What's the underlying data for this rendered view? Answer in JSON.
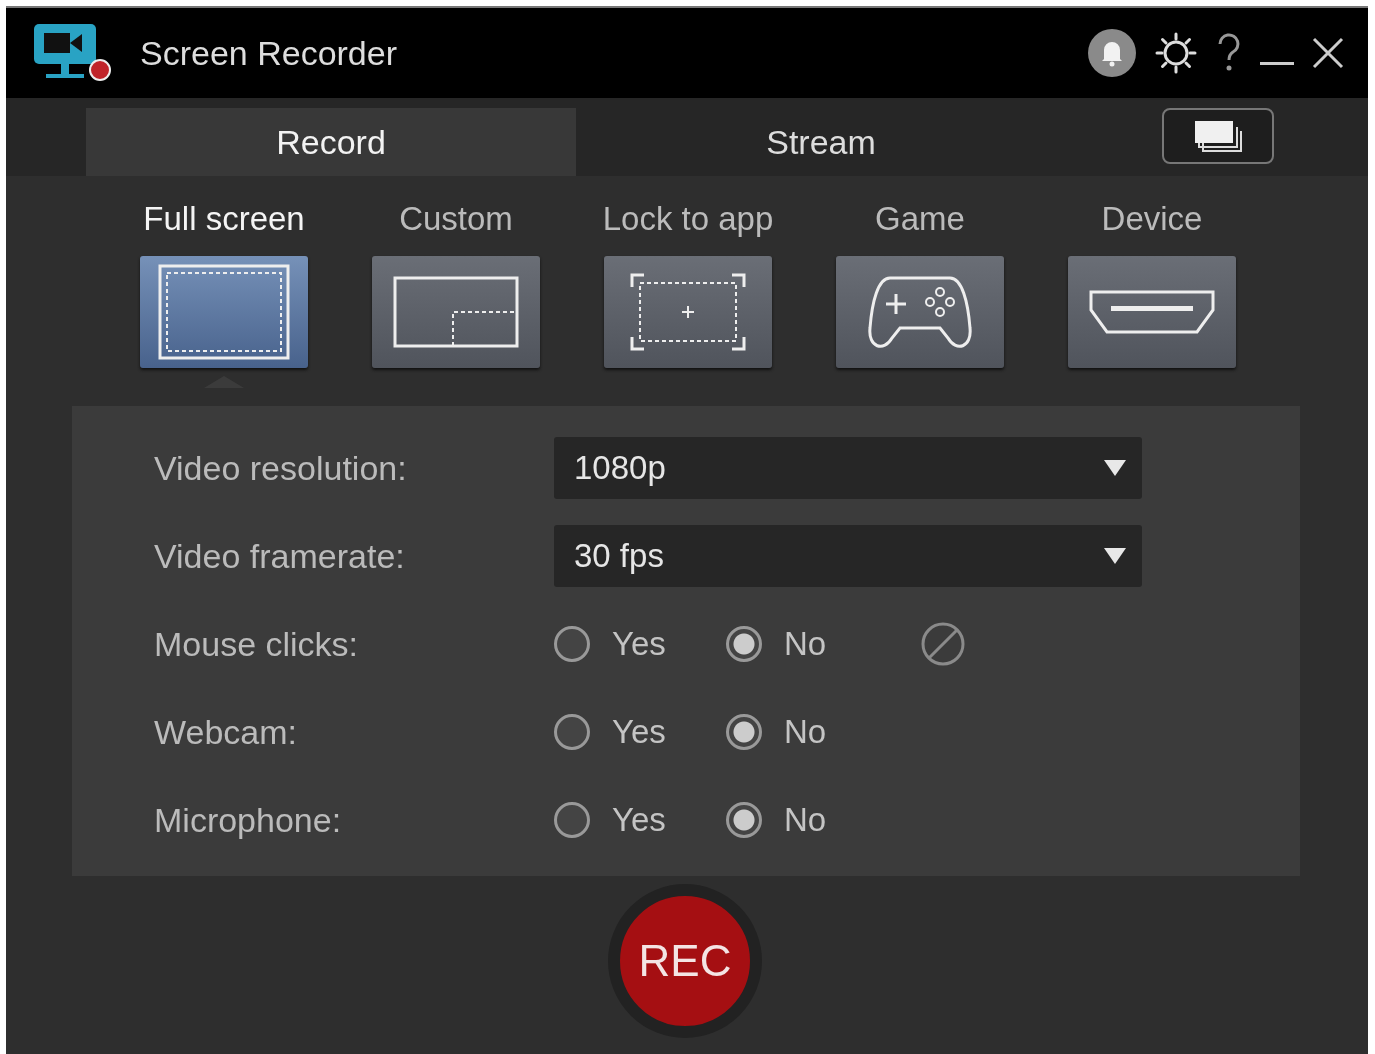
{
  "window": {
    "title": "Screen Recorder"
  },
  "tabs": [
    {
      "label": "Record",
      "selected": true
    },
    {
      "label": "Stream",
      "selected": false
    }
  ],
  "modes": [
    {
      "label": "Full screen",
      "kind": "fullscreen",
      "selected": true
    },
    {
      "label": "Custom",
      "kind": "custom",
      "selected": false
    },
    {
      "label": "Lock to app",
      "kind": "lock",
      "selected": false
    },
    {
      "label": "Game",
      "kind": "game",
      "selected": false
    },
    {
      "label": "Device",
      "kind": "device",
      "selected": false
    }
  ],
  "settings": [
    {
      "kind": "dropdown",
      "label": "Video resolution:",
      "value": "1080p"
    },
    {
      "kind": "dropdown",
      "label": "Video framerate:",
      "value": "30 fps"
    },
    {
      "kind": "radio",
      "label": "Mouse clicks:",
      "blocked": true,
      "options": [
        {
          "label": "Yes",
          "selected": false
        },
        {
          "label": "No",
          "selected": true
        }
      ]
    },
    {
      "kind": "radio",
      "label": "Webcam:",
      "blocked": false,
      "options": [
        {
          "label": "Yes",
          "selected": false
        },
        {
          "label": "No",
          "selected": true
        }
      ]
    },
    {
      "kind": "radio",
      "label": "Microphone:",
      "blocked": false,
      "options": [
        {
          "label": "Yes",
          "selected": false
        },
        {
          "label": "No",
          "selected": true
        }
      ]
    }
  ],
  "record_button": {
    "label": "REC"
  }
}
